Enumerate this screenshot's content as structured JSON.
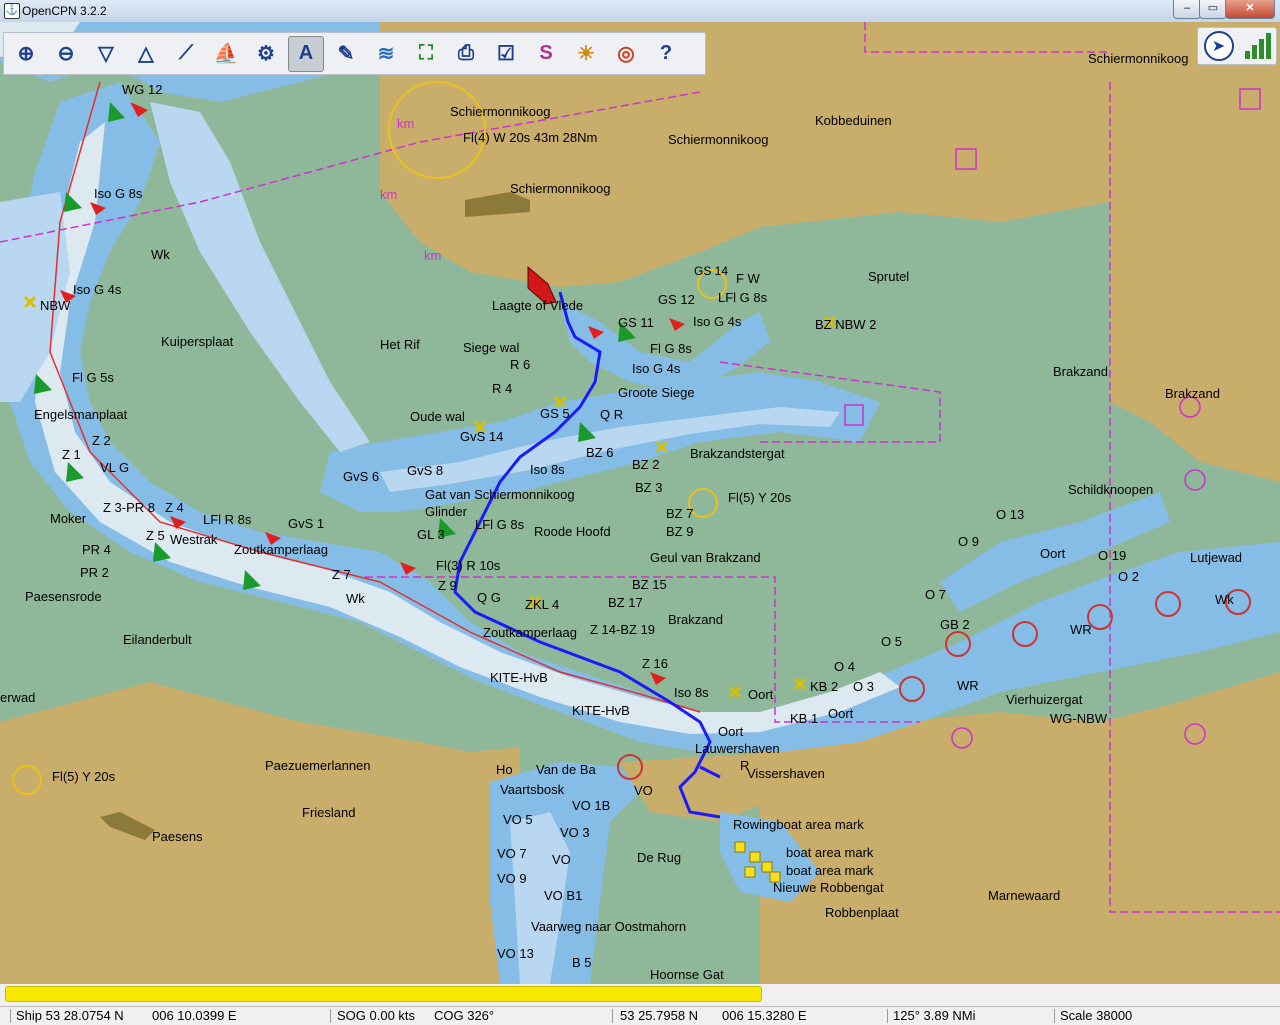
{
  "window": {
    "title": "OpenCPN 3.2.2",
    "min_glyph": "–",
    "max_glyph": "▭",
    "close_glyph": "✕"
  },
  "toolbar": {
    "buttons": [
      {
        "name": "zoom-in-icon",
        "glyph": "⊕"
      },
      {
        "name": "zoom-out-icon",
        "glyph": "⊖"
      },
      {
        "name": "chart-scale-down-icon",
        "glyph": "▽"
      },
      {
        "name": "chart-scale-up-icon",
        "glyph": "△"
      },
      {
        "name": "route-icon",
        "glyph": "⟋"
      },
      {
        "name": "auto-follow-icon",
        "glyph": "⛵"
      },
      {
        "name": "settings-icon",
        "glyph": "⚙"
      },
      {
        "name": "text-toggle-icon",
        "glyph": "A"
      },
      {
        "name": "current-icon",
        "glyph": "✎"
      },
      {
        "name": "tide-icon",
        "glyph": "≋"
      },
      {
        "name": "ais-icon",
        "glyph": "⛶"
      },
      {
        "name": "print-icon",
        "glyph": "⎙"
      },
      {
        "name": "route-manager-icon",
        "glyph": "☑"
      },
      {
        "name": "track-icon",
        "glyph": "S"
      },
      {
        "name": "color-scheme-icon",
        "glyph": "☀"
      },
      {
        "name": "mob-icon",
        "glyph": "◎"
      },
      {
        "name": "help-icon",
        "glyph": "?"
      }
    ]
  },
  "colors": {
    "land": "#c9ad6b",
    "drying": "#8fb89a",
    "shallow": "#86bde6",
    "medium": "#b9d7f1",
    "deep": "#dde9f1",
    "route": "#1a1aff",
    "buoy_red": "#e02020",
    "buoy_green": "#1a9a2a",
    "magenta": "#cc33cc"
  },
  "map_labels": [
    {
      "text": "Schiermonnikoog"
    },
    {
      "text": "Fl(4) W 20s 43m 28Nm"
    },
    {
      "text": "Schiermonnikoog"
    },
    {
      "text": "Kobbeduinen"
    },
    {
      "text": "Schiermonnikoog"
    },
    {
      "text": "Schiermonnikoog"
    },
    {
      "text": "WG 12"
    },
    {
      "text": "Iso G 8s"
    },
    {
      "text": "Wk"
    },
    {
      "text": "Iso G 4s"
    },
    {
      "text": "NBW"
    },
    {
      "text": "Kuipersplaat"
    },
    {
      "text": "Het Rif"
    },
    {
      "text": "Siege wal"
    },
    {
      "text": "Laagte of Vlede"
    },
    {
      "text": "Sprutel"
    },
    {
      "text": "F W"
    },
    {
      "text": "LFl G 8s"
    },
    {
      "text": "GS 14"
    },
    {
      "text": "GS 12"
    },
    {
      "text": "Iso G 4s"
    },
    {
      "text": "BZ NBW 2"
    },
    {
      "text": "GS 11"
    },
    {
      "text": "Fl G 8s"
    },
    {
      "text": "Iso G 4s"
    },
    {
      "text": "Groote Siege"
    },
    {
      "text": "R 6"
    },
    {
      "text": "R 4"
    },
    {
      "text": "Q R"
    },
    {
      "text": "Oude wal"
    },
    {
      "text": "Brakzand"
    },
    {
      "text": "Brakzand"
    },
    {
      "text": "Engelsmanplaat"
    },
    {
      "text": "Fl G 5s"
    },
    {
      "text": "GvS 14"
    },
    {
      "text": "GS 5"
    },
    {
      "text": "Iso 8s"
    },
    {
      "text": "BZ 6"
    },
    {
      "text": "BZ 2"
    },
    {
      "text": "Brakzandstergat"
    },
    {
      "text": "Z 2"
    },
    {
      "text": "Z 1"
    },
    {
      "text": "VL G"
    },
    {
      "text": "GvS 6"
    },
    {
      "text": "GvS 8"
    },
    {
      "text": "BZ 3"
    },
    {
      "text": "Schildknoopen"
    },
    {
      "text": "Gat van Schiermonnikoog"
    },
    {
      "text": "Glinder"
    },
    {
      "text": "Fl(5) Y 20s"
    },
    {
      "text": "BZ 7"
    },
    {
      "text": "Moker"
    },
    {
      "text": "Z 3-PR 8"
    },
    {
      "text": "Z 4"
    },
    {
      "text": "LFl R 8s"
    },
    {
      "text": "GvS 1"
    },
    {
      "text": "LFl G 8s"
    },
    {
      "text": "Roode Hoofd"
    },
    {
      "text": "BZ 9"
    },
    {
      "text": "O 13"
    },
    {
      "text": "O 9"
    },
    {
      "text": "Oort"
    },
    {
      "text": "O 19"
    },
    {
      "text": "Lutjewad"
    },
    {
      "text": "GL 3"
    },
    {
      "text": "Z 5"
    },
    {
      "text": "Westrak"
    },
    {
      "text": "Zoutkamperlaag"
    },
    {
      "text": "PR 4"
    },
    {
      "text": "Geul van Brakzand"
    },
    {
      "text": "PR 2"
    },
    {
      "text": "Fl(3) R 10s"
    },
    {
      "text": "Z 7"
    },
    {
      "text": "Wk"
    },
    {
      "text": "BZ 15"
    },
    {
      "text": "O 2"
    },
    {
      "text": "Paesensrode"
    },
    {
      "text": "Z 9"
    },
    {
      "text": "Q G"
    },
    {
      "text": "ZKL 4"
    },
    {
      "text": "BZ 17"
    },
    {
      "text": "Brakzand"
    },
    {
      "text": "O 7"
    },
    {
      "text": "GB 2"
    },
    {
      "text": "Wk"
    },
    {
      "text": "Eilanderbult"
    },
    {
      "text": "Zoutkamperlaag"
    },
    {
      "text": "Z 14-BZ 19"
    },
    {
      "text": "O 5"
    },
    {
      "text": "WR"
    },
    {
      "text": "Z 16"
    },
    {
      "text": "O 4"
    },
    {
      "text": "KB 2"
    },
    {
      "text": "O 3"
    },
    {
      "text": "KITE-HvB"
    },
    {
      "text": "Iso 8s"
    },
    {
      "text": "Oort"
    },
    {
      "text": "WR"
    },
    {
      "text": "Vierhuizergat"
    },
    {
      "text": "erwad"
    },
    {
      "text": "KITE-HvB"
    },
    {
      "text": "KB 1"
    },
    {
      "text": "Oort"
    },
    {
      "text": "WG-NBW"
    },
    {
      "text": "Oort"
    },
    {
      "text": "Lauwershaven"
    },
    {
      "text": "Fl(5) Y 20s"
    },
    {
      "text": "Paezuemerlannen"
    },
    {
      "text": "Ho"
    },
    {
      "text": "Van de Ba"
    },
    {
      "text": "R"
    },
    {
      "text": "Vissershaven"
    },
    {
      "text": "Friesland"
    },
    {
      "text": "Vaartsbosk"
    },
    {
      "text": "VO"
    },
    {
      "text": "VO 1B"
    },
    {
      "text": "Paesens"
    },
    {
      "text": "Rowingboat area mark"
    },
    {
      "text": "VO 5"
    },
    {
      "text": "VO 3"
    },
    {
      "text": "boat area mark"
    },
    {
      "text": "De Rug"
    },
    {
      "text": "VO 7"
    },
    {
      "text": "VO"
    },
    {
      "text": "boat area mark"
    },
    {
      "text": "VO 9"
    },
    {
      "text": "Nieuwe Robbengat"
    },
    {
      "text": "VO B1"
    },
    {
      "text": "Marnewaard"
    },
    {
      "text": "Robbenplaat"
    },
    {
      "text": "Vaarweg naar Oostmahorn"
    },
    {
      "text": "VO 13"
    },
    {
      "text": "B 5"
    },
    {
      "text": "Hoornse Gat"
    },
    {
      "text": "km"
    },
    {
      "text": "km"
    },
    {
      "text": "km"
    }
  ],
  "progress": {
    "value": 0.59
  },
  "status": {
    "ship": "Ship 53 28.0754 N",
    "ship_lon": "006 10.0399 E",
    "sog": "SOG 0.00 kts",
    "cog": "COG 326°",
    "cursor_lat": "53 25.7958 N",
    "cursor_lon": "006 15.3280 E",
    "brg_dist": "125°  3.89 NMi",
    "scale": "Scale 38000"
  }
}
